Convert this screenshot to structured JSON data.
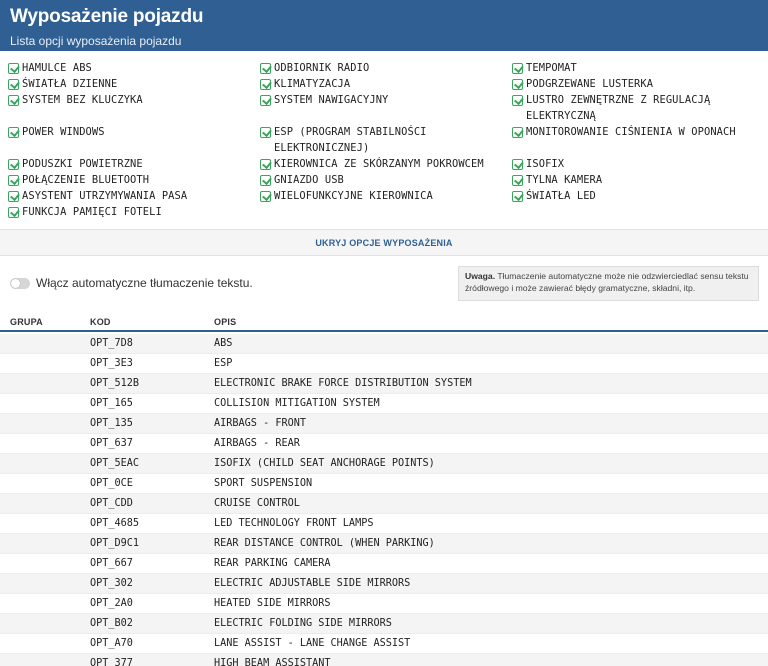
{
  "header": {
    "title": "Wyposażenie pojazdu",
    "subtitle": "Lista opcji wyposażenia pojazdu"
  },
  "features": {
    "col1": [
      "HAMULCE ABS",
      "ŚWIATŁA DZIENNE",
      "SYSTEM BEZ KLUCZYKA",
      "POWER WINDOWS",
      "PODUSZKI POWIETRZNE",
      "POŁĄCZENIE BLUETOOTH",
      "ASYSTENT UTRZYMYWANIA PASA",
      "FUNKCJA PAMIĘCI FOTELI"
    ],
    "col2": [
      "ODBIORNIK RADIO",
      "KLIMATYZACJA",
      "SYSTEM NAWIGACYJNY",
      "ESP (PROGRAM STABILNOŚCI",
      "ELEKTRONICZNEJ)",
      "KIEROWNICA ZE SKÓRZANYM POKROWCEM",
      "GNIAZDO USB",
      "WIELOFUNKCYJNE KIEROWNICA"
    ],
    "col3": [
      "TEMPOMAT",
      "PODGRZEWANE LUSTERKA",
      "LUSTRO ZEWNĘTRZNE Z REGULACJĄ",
      "ELEKTRYCZNĄ",
      "MONITOROWANIE CIŚNIENIA W OPONACH",
      "ISOFIX",
      "TYLNA KAMERA",
      "ŚWIATŁA LED"
    ]
  },
  "toggle_options_label": "UKRYJ OPCJE WYPOSAŻENIA",
  "translate": {
    "label": "Włącz automatyczne tłumaczenie tekstu.",
    "enabled": false
  },
  "note": {
    "bold": "Uwaga.",
    "text": " Tłumaczenie automatyczne może nie odzwierciedlać sensu tekstu źródłowego i może zawierać błędy gramatyczne, składni, itp."
  },
  "table": {
    "headers": [
      "GRUPA",
      "KOD",
      "OPIS"
    ],
    "rows": [
      {
        "group": "",
        "code": "OPT_7D8",
        "desc": "ABS"
      },
      {
        "group": "",
        "code": "OPT_3E3",
        "desc": "ESP"
      },
      {
        "group": "",
        "code": "OPT_512B",
        "desc": "ELECTRONIC BRAKE FORCE DISTRIBUTION SYSTEM"
      },
      {
        "group": "",
        "code": "OPT_165",
        "desc": "COLLISION MITIGATION SYSTEM"
      },
      {
        "group": "",
        "code": "OPT_135",
        "desc": "AIRBAGS - FRONT"
      },
      {
        "group": "",
        "code": "OPT_637",
        "desc": "AIRBAGS - REAR"
      },
      {
        "group": "",
        "code": "OPT_5EAC",
        "desc": "ISOFIX (CHILD SEAT ANCHORAGE POINTS)"
      },
      {
        "group": "",
        "code": "OPT_0CE",
        "desc": "SPORT SUSPENSION"
      },
      {
        "group": "",
        "code": "OPT_CDD",
        "desc": "CRUISE CONTROL"
      },
      {
        "group": "",
        "code": "OPT_4685",
        "desc": "LED TECHNOLOGY FRONT LAMPS"
      },
      {
        "group": "",
        "code": "OPT_D9C1",
        "desc": "REAR DISTANCE CONTROL (WHEN PARKING)"
      },
      {
        "group": "",
        "code": "OPT_667",
        "desc": "REAR PARKING CAMERA"
      },
      {
        "group": "",
        "code": "OPT_302",
        "desc": "ELECTRIC ADJUSTABLE SIDE MIRRORS"
      },
      {
        "group": "",
        "code": "OPT_2A0",
        "desc": "HEATED SIDE MIRRORS"
      },
      {
        "group": "",
        "code": "OPT_B02",
        "desc": "ELECTRIC FOLDING SIDE MIRRORS"
      },
      {
        "group": "",
        "code": "OPT_A70",
        "desc": "LANE ASSIST - LANE CHANGE ASSIST"
      },
      {
        "group": "",
        "code": "OPT_377",
        "desc": "HIGH BEAM ASSISTANT"
      }
    ]
  },
  "colors": {
    "header_bg": "#2f5f93",
    "check_green": "#3aa55c",
    "link_blue": "#2f5f93"
  },
  "icons": {
    "feature_check": "check-square-icon"
  }
}
